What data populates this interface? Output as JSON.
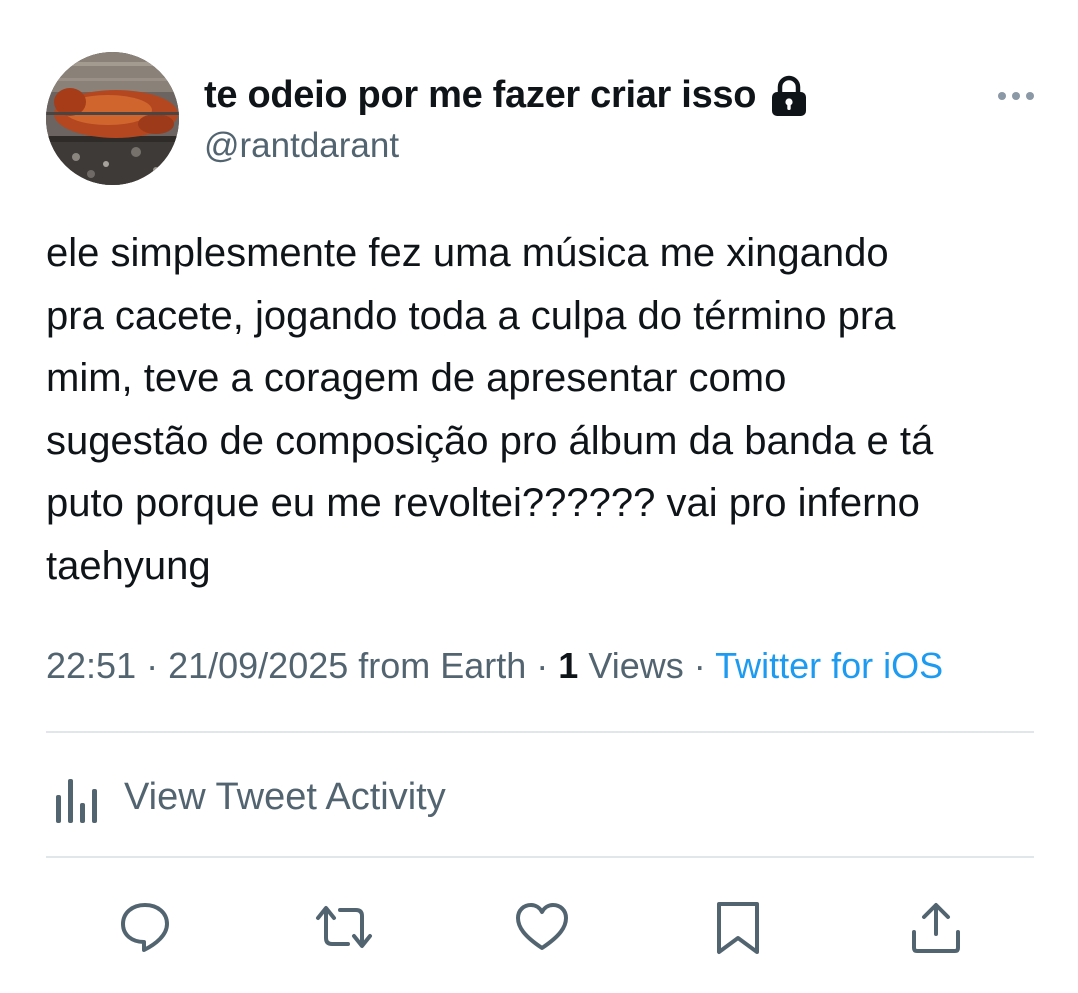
{
  "author": {
    "display_name": "te odeio por me fazer criar isso",
    "handle": "@rantdarant",
    "protected_icon": "lock-icon",
    "avatar_icon": "roast-pig-photo"
  },
  "more_icon": "ellipsis-icon",
  "tweet": {
    "text_lines": [
      "ele simplesmente fez uma música me xingando",
      "pra cacete, jogando toda a culpa do término pra",
      "mim, teve a coragem de apresentar como",
      "sugestão de composição pro álbum da banda e tá",
      "puto porque eu me revoltei?????? vai pro inferno",
      "taehyung"
    ]
  },
  "meta": {
    "timestamp": "22:51 · 21/09/2025 from Earth · ",
    "views_count": "1",
    "views_label": " Views · ",
    "source": "Twitter for iOS"
  },
  "activity": {
    "label": "View Tweet Activity",
    "icon": "bar-chart-icon"
  },
  "actions": {
    "reply_icon": "reply-icon",
    "retweet_icon": "retweet-icon",
    "like_icon": "heart-icon",
    "bookmark_icon": "bookmark-icon",
    "share_icon": "share-icon"
  },
  "colors": {
    "text": "#0f1419",
    "secondary": "#536471",
    "link": "#1d9bf0",
    "divider": "#e1e6ea"
  }
}
